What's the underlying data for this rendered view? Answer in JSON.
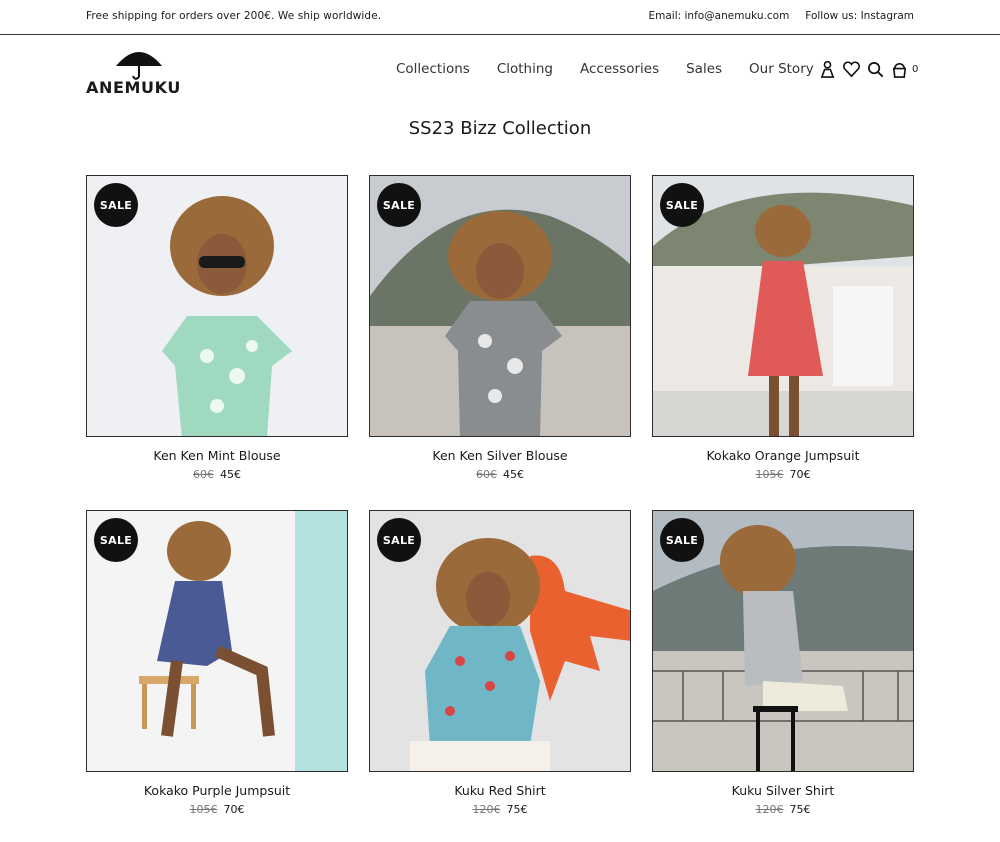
{
  "topbar": {
    "shipping": "Free shipping for orders over 200€. We ship worldwide.",
    "email": "Email: info@anemuku.com",
    "follow": "Follow us: Instagram"
  },
  "brand": {
    "name": "ANEMUKU"
  },
  "nav": [
    "Collections",
    "Clothing",
    "Accessories",
    "Sales",
    "Our Story"
  ],
  "header_icons": [
    "user-icon",
    "heart-icon",
    "search-icon",
    "bag-icon"
  ],
  "cart_count": "0",
  "page_title": "SS23 Bizz Collection",
  "badge_label": "SALE",
  "products": [
    {
      "name": "Ken Ken Mint Blouse",
      "old_price": "60€",
      "price": "45€",
      "bg": "#eef0f3",
      "garment": "#9fd9bf"
    },
    {
      "name": "Ken Ken Silver Blouse",
      "old_price": "60€",
      "price": "45€",
      "bg": "#c8ccd0",
      "garment": "#8a8d90"
    },
    {
      "name": "Kokako Orange Jumpsuit",
      "old_price": "105€",
      "price": "70€",
      "bg": "#dfe3e6",
      "garment": "#e05a57"
    },
    {
      "name": "Kokako Purple Jumpsuit",
      "old_price": "105€",
      "price": "70€",
      "bg": "#f4f4f4",
      "garment": "#4a5a95"
    },
    {
      "name": "Kuku Red Shirt",
      "old_price": "120€",
      "price": "75€",
      "bg": "#e3e3e3",
      "garment": "#6fb6c6"
    },
    {
      "name": "Kuku Silver Shirt",
      "old_price": "120€",
      "price": "75€",
      "bg": "#b4bcc3",
      "garment": "#b9bcc0"
    }
  ]
}
